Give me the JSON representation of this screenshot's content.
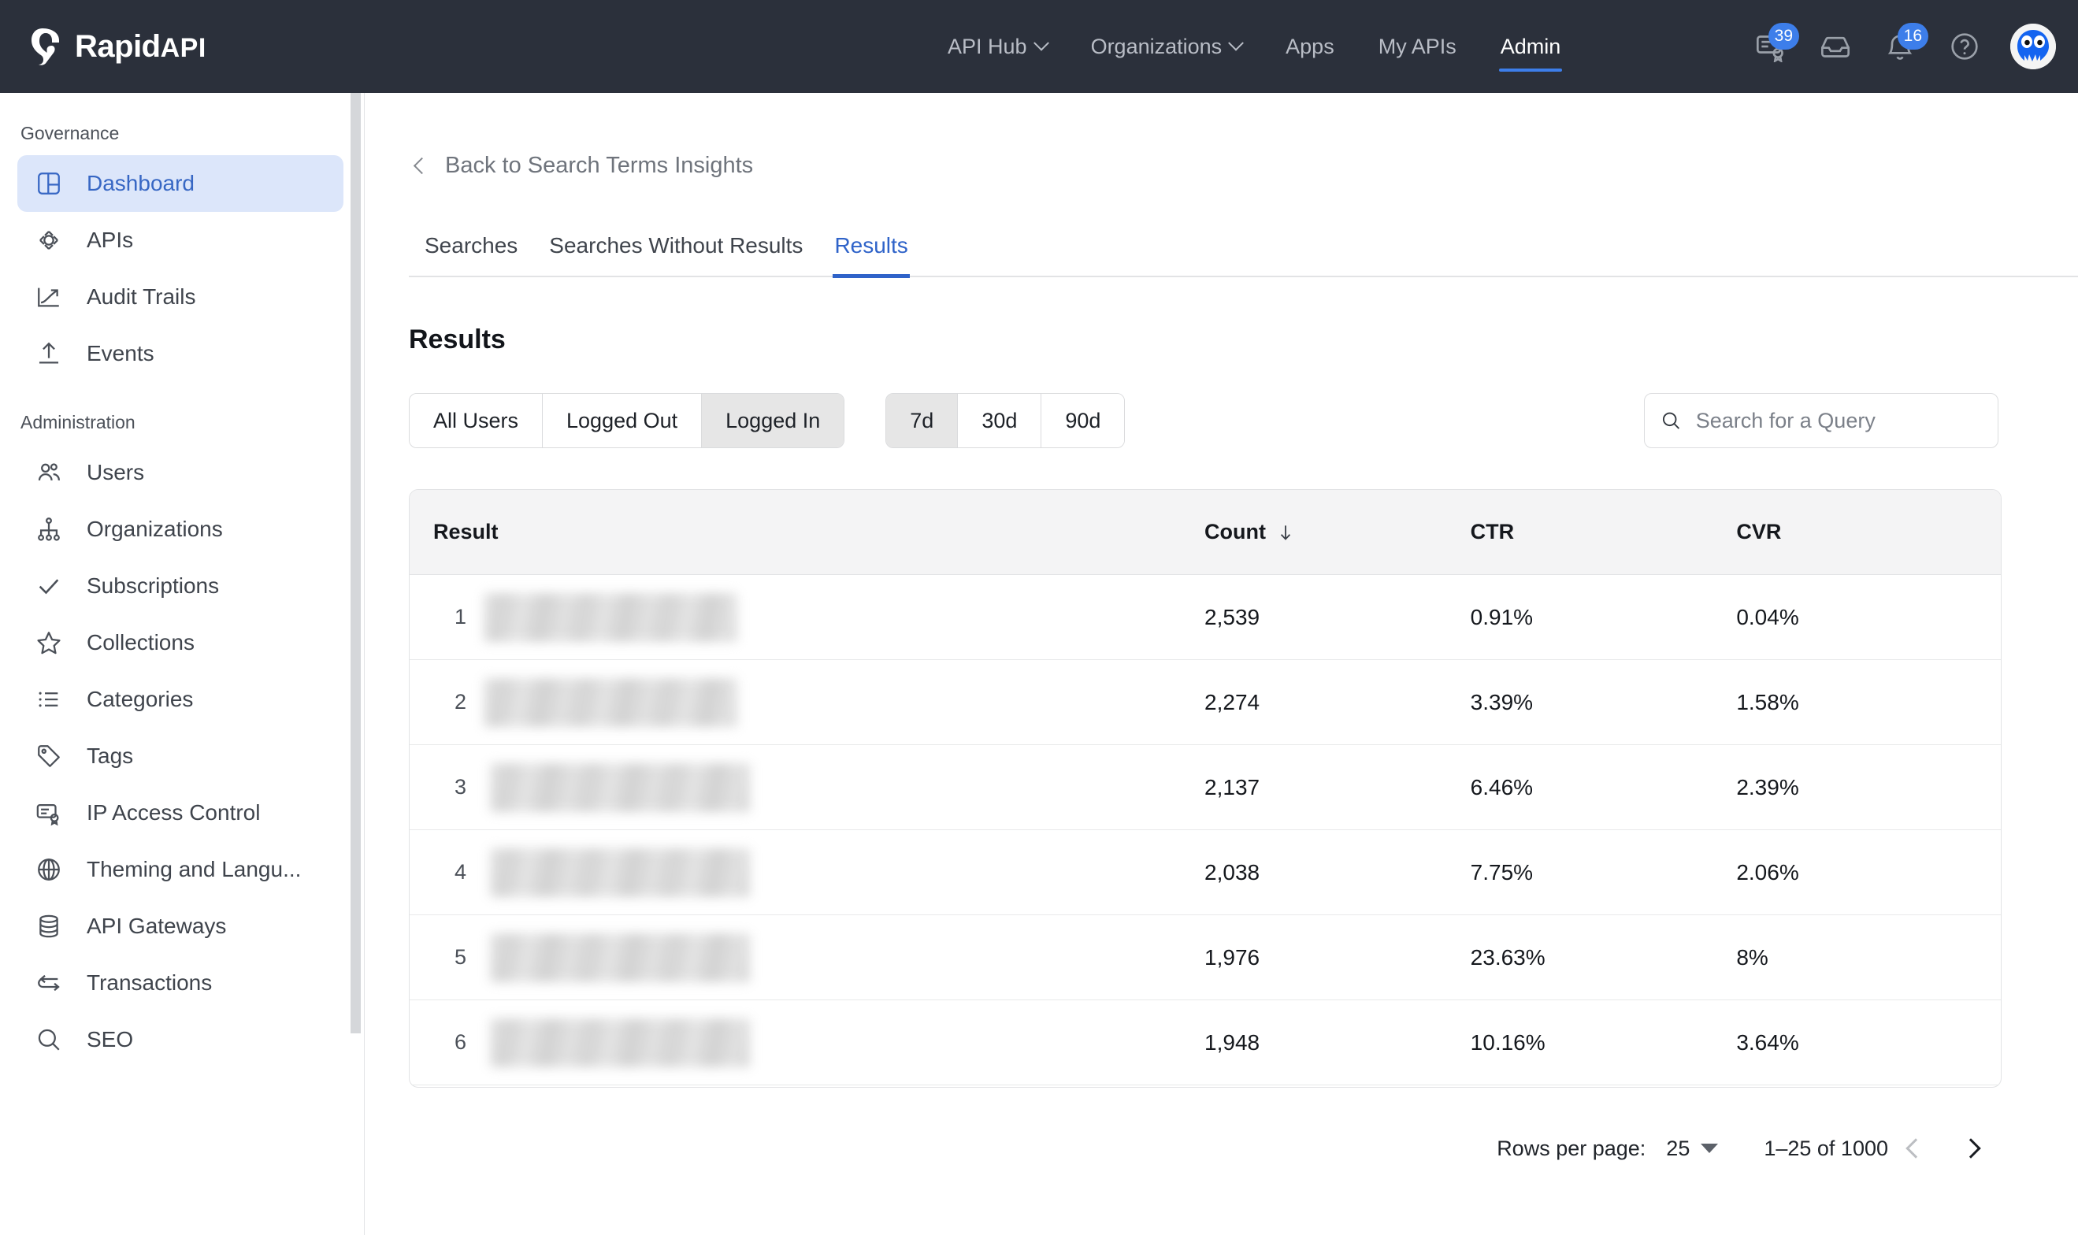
{
  "brand": {
    "name": "Rapid",
    "suffix": "API",
    "logo_icon": "rapidapi-logo-icon"
  },
  "topnav": {
    "items": [
      {
        "label": "API Hub",
        "has_dropdown": true,
        "active": false
      },
      {
        "label": "Organizations",
        "has_dropdown": true,
        "active": false
      },
      {
        "label": "Apps",
        "has_dropdown": false,
        "active": false
      },
      {
        "label": "My APIs",
        "has_dropdown": false,
        "active": false
      },
      {
        "label": "Admin",
        "has_dropdown": false,
        "active": true
      }
    ],
    "icons": [
      {
        "name": "certificate-icon",
        "badge": "39"
      },
      {
        "name": "inbox-icon",
        "badge": ""
      },
      {
        "name": "bell-icon",
        "badge": "16"
      },
      {
        "name": "help-circle-icon",
        "badge": ""
      }
    ],
    "avatar_name": "user-avatar"
  },
  "sidebar": {
    "sections": [
      {
        "title": "Governance",
        "items": [
          {
            "label": "Dashboard",
            "icon": "dashboard-icon",
            "active": true
          },
          {
            "label": "APIs",
            "icon": "apis-icon",
            "active": false
          },
          {
            "label": "Audit Trails",
            "icon": "trending-up-icon",
            "active": false
          },
          {
            "label": "Events",
            "icon": "upload-icon",
            "active": false
          }
        ]
      },
      {
        "title": "Administration",
        "items": [
          {
            "label": "Users",
            "icon": "users-icon",
            "active": false
          },
          {
            "label": "Organizations",
            "icon": "org-tree-icon",
            "active": false
          },
          {
            "label": "Subscriptions",
            "icon": "check-icon",
            "active": false
          },
          {
            "label": "Collections",
            "icon": "star-icon",
            "active": false
          },
          {
            "label": "Categories",
            "icon": "list-icon",
            "active": false
          },
          {
            "label": "Tags",
            "icon": "tag-icon",
            "active": false
          },
          {
            "label": "IP Access Control",
            "icon": "certificate-icon",
            "active": false
          },
          {
            "label": "Theming and Langu...",
            "icon": "globe-icon",
            "active": false
          },
          {
            "label": "API Gateways",
            "icon": "database-icon",
            "active": false
          },
          {
            "label": "Transactions",
            "icon": "refresh-icon",
            "active": false
          },
          {
            "label": "SEO",
            "icon": "search-icon",
            "active": false
          }
        ]
      }
    ]
  },
  "main": {
    "back_label": "Back to Search Terms Insights",
    "tabs": [
      {
        "label": "Searches",
        "active": false
      },
      {
        "label": "Searches Without Results",
        "active": false
      },
      {
        "label": "Results",
        "active": true
      }
    ],
    "page_title": "Results",
    "user_filter": [
      {
        "label": "All Users",
        "selected": false
      },
      {
        "label": "Logged Out",
        "selected": false
      },
      {
        "label": "Logged In",
        "selected": true
      }
    ],
    "range_filter": [
      {
        "label": "7d",
        "selected": true
      },
      {
        "label": "30d",
        "selected": false
      },
      {
        "label": "90d",
        "selected": false
      }
    ],
    "search": {
      "placeholder": "Search for a Query",
      "value": "",
      "icon": "search-icon"
    }
  },
  "table": {
    "columns": [
      {
        "key": "result",
        "label": "Result",
        "sorted": false
      },
      {
        "key": "count",
        "label": "Count",
        "sorted": true,
        "sort_dir": "desc",
        "sort_icon": "arrow-down-icon"
      },
      {
        "key": "ctr",
        "label": "CTR",
        "sorted": false
      },
      {
        "key": "cvr",
        "label": "CVR",
        "sorted": false
      }
    ],
    "rows": [
      {
        "rank": "1",
        "result": "",
        "redacted": true,
        "redact_width": 322,
        "count": "2,539",
        "ctr": "0.91%",
        "cvr": "0.04%"
      },
      {
        "rank": "2",
        "result": "",
        "redacted": true,
        "redact_width": 322,
        "count": "2,274",
        "ctr": "3.39%",
        "cvr": "1.58%"
      },
      {
        "rank": "3",
        "result": "",
        "redacted": true,
        "redact_width": 330,
        "count": "2,137",
        "ctr": "6.46%",
        "cvr": "2.39%"
      },
      {
        "rank": "4",
        "result": "",
        "redacted": true,
        "redact_width": 330,
        "count": "2,038",
        "ctr": "7.75%",
        "cvr": "2.06%"
      },
      {
        "rank": "5",
        "result": "",
        "redacted": true,
        "redact_width": 330,
        "count": "1,976",
        "ctr": "23.63%",
        "cvr": "8%"
      },
      {
        "rank": "6",
        "result": "",
        "redacted": true,
        "redact_width": 330,
        "count": "1,948",
        "ctr": "10.16%",
        "cvr": "3.64%"
      }
    ]
  },
  "pagination": {
    "rows_per_page_label": "Rows per page:",
    "rows_per_page_value": "25",
    "range_label": "1–25 of 1000",
    "prev_icon": "chevron-left-icon",
    "next_icon": "chevron-right-icon",
    "prev_disabled": true
  },
  "colors": {
    "topbar_bg": "#2b303b",
    "accent_blue": "#3d7eea",
    "tab_active": "#2f63c9",
    "sidebar_active_bg": "#dce6fa",
    "sidebar_active_text": "#3767c4",
    "table_header_bg": "#f4f4f5",
    "segment_selected_bg": "#e6e6e6"
  }
}
